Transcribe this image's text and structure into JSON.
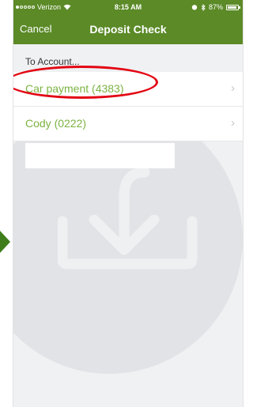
{
  "status_bar": {
    "carrier": "Verizon",
    "time": "8:15 AM",
    "battery": "87%",
    "signal_icon": "signal-dots-icon",
    "wifi_icon": "wifi-icon",
    "alarm_icon": "alarm-icon",
    "bluetooth_icon": "bluetooth-icon"
  },
  "nav": {
    "cancel_label": "Cancel",
    "title": "Deposit Check"
  },
  "section": {
    "header": "To Account..."
  },
  "accounts": [
    {
      "label": "Car payment  (4383)",
      "chevron": "›"
    },
    {
      "label": "Cody  (0222)",
      "chevron": "›"
    }
  ],
  "colors": {
    "brand_green": "#5b8a27",
    "account_text": "#7cb342",
    "highlight_red": "#e30613"
  }
}
